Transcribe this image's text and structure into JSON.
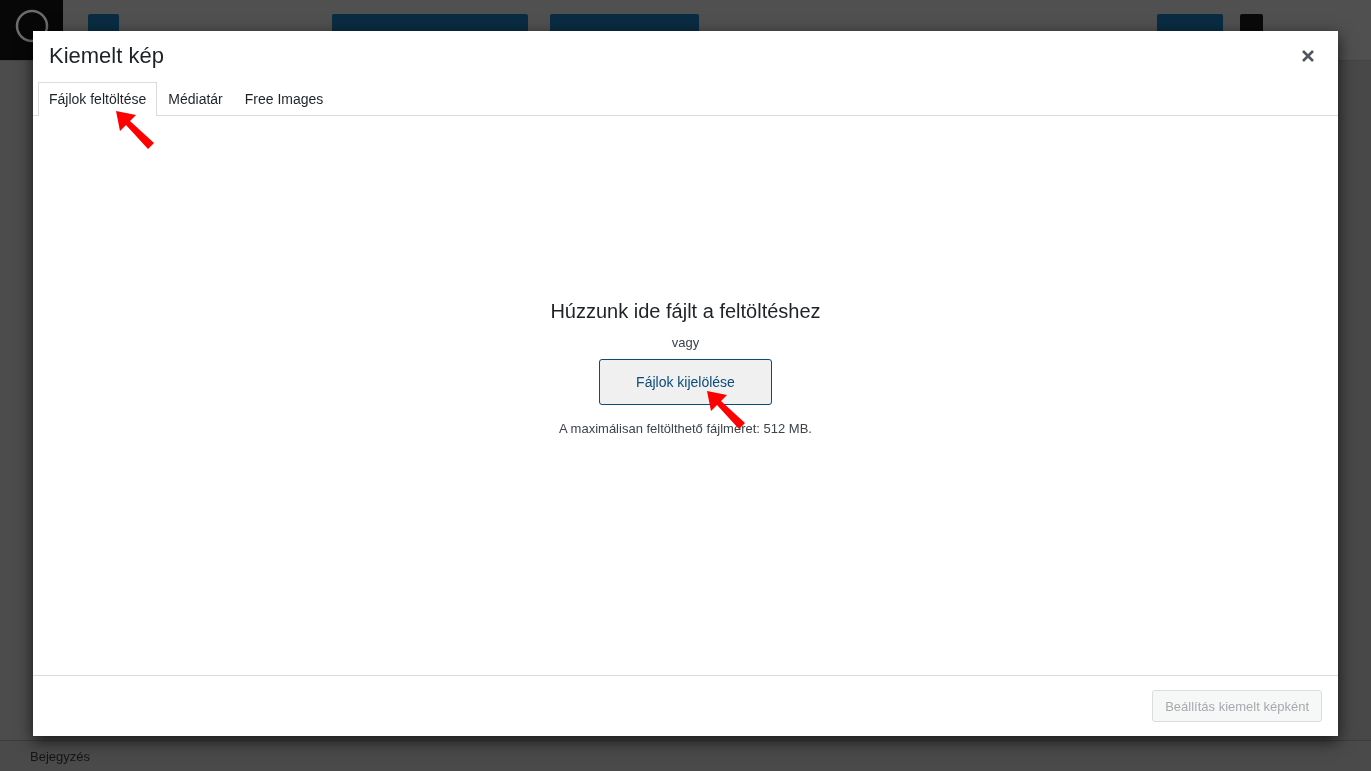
{
  "modal": {
    "title": "Kiemelt kép",
    "tabs": [
      {
        "label": "Fájlok feltöltése",
        "selected": true
      },
      {
        "label": "Médiatár",
        "selected": false
      },
      {
        "label": "Free Images",
        "selected": false
      }
    ],
    "upload": {
      "heading": "Húzzunk ide fájlt a feltöltéshez",
      "or": "vagy",
      "button": "Fájlok kijelölése",
      "max_size": "A maximálisan feltölthető fájlméret: 512 MB."
    },
    "footer": {
      "button": "Beállítás kiemelt képként",
      "disabled": true
    }
  },
  "status_bar": {
    "label": "Bejegyzés"
  }
}
